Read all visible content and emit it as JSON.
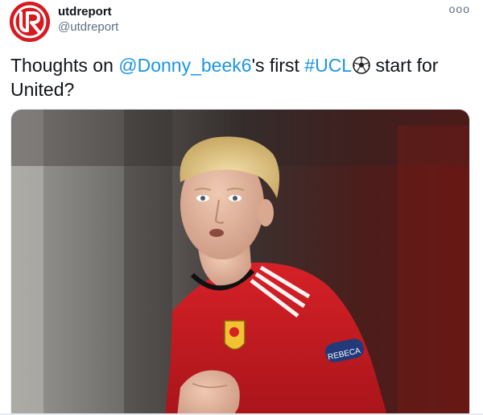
{
  "account": {
    "display_name": "utdreport",
    "handle": "@utdreport",
    "avatar_letters": "UR",
    "avatar_color": "#d71920"
  },
  "menu": {
    "more_label": "ooo"
  },
  "tweet": {
    "text_part1": "Thoughts on ",
    "mention": "@Donny_beek6",
    "text_part2": "'s first ",
    "hashtag": "#UCL",
    "text_part3": " start for United?",
    "link_color": "#1b95e0"
  },
  "media": {
    "badge_text": "REBECA"
  }
}
